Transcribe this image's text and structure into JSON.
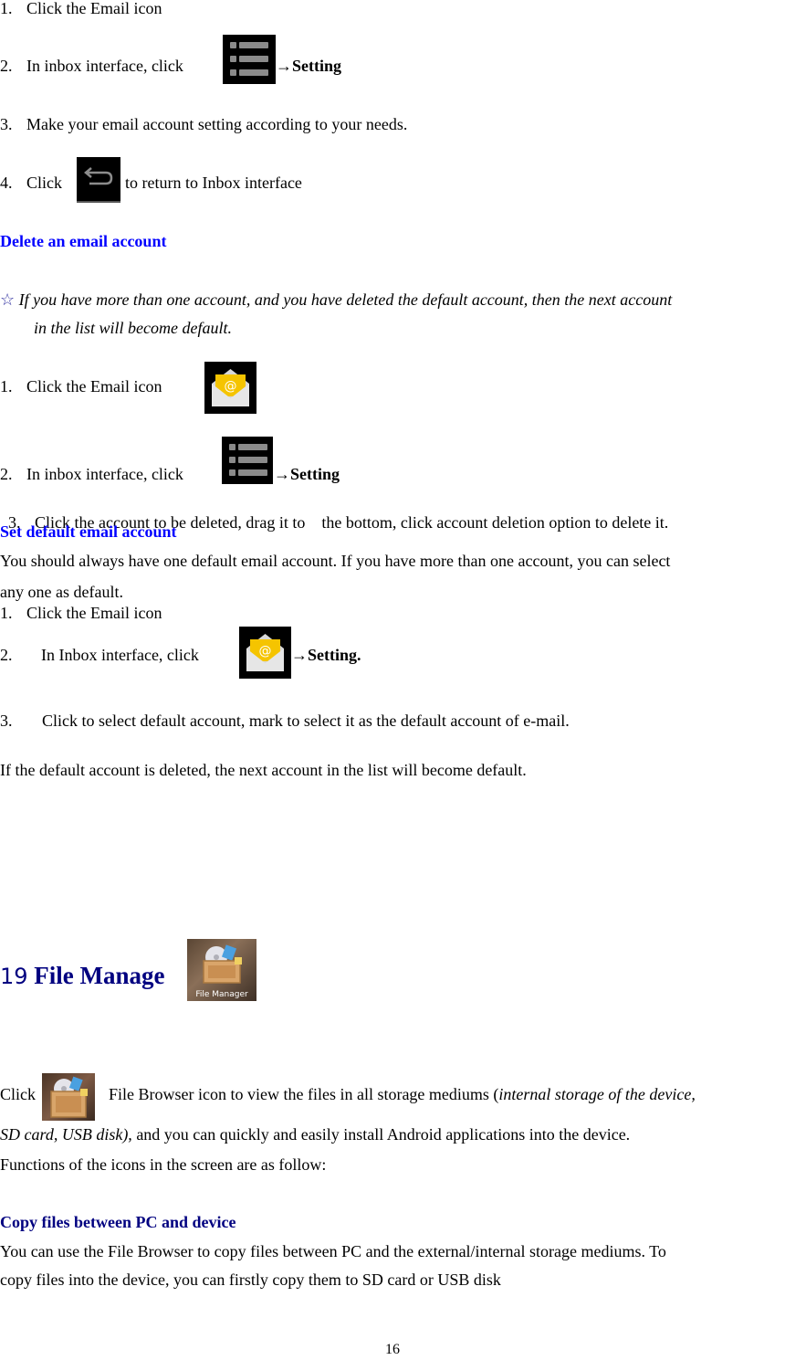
{
  "section_edit": {
    "steps": [
      {
        "num": "1.",
        "text": "Click the Email icon"
      },
      {
        "num": "2.",
        "text": "In inbox interface, click",
        "suffix": "→Setting"
      },
      {
        "num": "3.",
        "text": "Make your email account setting according to your needs."
      },
      {
        "num": "4.",
        "text_before": "Click",
        "text_after": "to return to Inbox interface"
      }
    ]
  },
  "section_delete": {
    "heading": "Delete an email account",
    "note_icon": "☆",
    "note_line1": "If you have more than one account, and you have deleted the default account, then the next account",
    "note_line2": "in the list will become default.",
    "steps": [
      {
        "num": "1.",
        "text": "Click the Email icon"
      },
      {
        "num": "2.",
        "text": "In inbox interface, click",
        "suffix": "→Setting"
      },
      {
        "num": "3.",
        "text": "Click the account to be deleted, drag it to    the bottom, click account deletion option to delete it."
      }
    ]
  },
  "section_default": {
    "heading": "Set default email account",
    "intro_line1": "You should always have one default email account. If you have more than one account, you can select",
    "intro_line2": "any one as default.",
    "steps": [
      {
        "num": "1.",
        "text": "Click the Email icon"
      },
      {
        "num": "2.",
        "text": "In Inbox interface, click",
        "suffix": "→Setting."
      },
      {
        "num": "3.",
        "text": "Click to select default account, mark to select it as the default account of e-mail."
      }
    ],
    "footer_note": "If the default account is deleted, the next account in the list will become default."
  },
  "section_file_manager": {
    "number": "19",
    "title": "File Manage",
    "icon_label": "File Manager",
    "para1_click": "Click",
    "para1_text": "File Browser icon to view the files in all storage mediums (",
    "para1_italic": "internal storage of the device,",
    "para2_italic": "SD card, USB disk),",
    "para2_text": " and you can quickly and easily install Android applications into the device.",
    "para3": "Functions of the icons in the screen are as follow:",
    "copy_heading": "Copy files between PC and device",
    "copy_line1": "You can use the File Browser to copy files between PC and the external/internal storage mediums. To",
    "copy_line2": "copy files into the device, you can firstly copy them to SD card or USB disk"
  },
  "page_number": "16",
  "colors": {
    "heading_blue": "#0000ff",
    "heading_navy": "#000080",
    "email_yellow": "#f5c400"
  }
}
